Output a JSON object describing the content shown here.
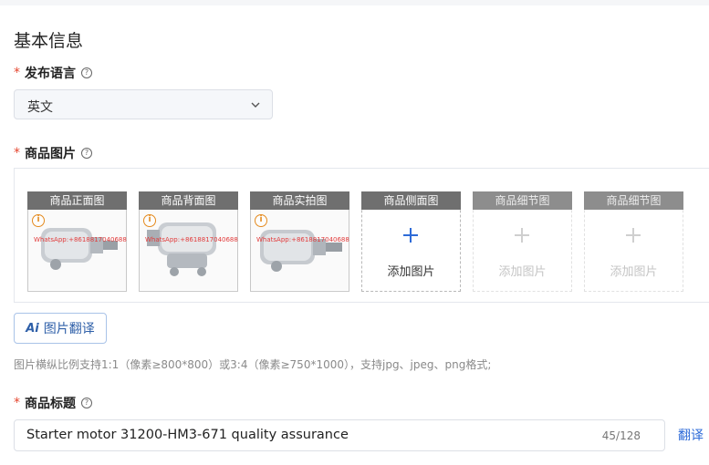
{
  "section": {
    "title": "基本信息"
  },
  "language": {
    "label": "发布语言",
    "required_mark": "*",
    "help_icon": "question-circle-icon",
    "selected": "英文"
  },
  "images": {
    "label": "商品图片",
    "required_mark": "*",
    "help_icon": "question-circle-icon",
    "watermark_text": "WhatsApp:+8618817040688",
    "slots": [
      {
        "title": "商品正面图",
        "state": "filled"
      },
      {
        "title": "商品背面图",
        "state": "filled"
      },
      {
        "title": "商品实拍图",
        "state": "filled"
      },
      {
        "title": "商品侧面图",
        "state": "empty",
        "add_label": "添加图片"
      },
      {
        "title": "商品细节图",
        "state": "disabled",
        "add_label": "添加图片"
      },
      {
        "title": "商品细节图",
        "state": "disabled",
        "add_label": "添加图片"
      }
    ],
    "ai_button_label": "图片翻译",
    "ai_mark": "Ai",
    "hint": "图片横纵比例支持1:1（像素≥800*800）或3:4（像素≥750*1000），支持jpg、jpeg、png格式;"
  },
  "product_title": {
    "label": "商品标题",
    "required_mark": "*",
    "help_icon": "question-circle-icon",
    "value": "Starter motor 31200-HM3-671 quality assurance",
    "count": "45/128",
    "translate_label": "翻译"
  },
  "colors": {
    "required": "#e5462f",
    "link": "#2e6bd8",
    "slot_header": "#6f6f6f",
    "warning": "#e48a1e"
  }
}
